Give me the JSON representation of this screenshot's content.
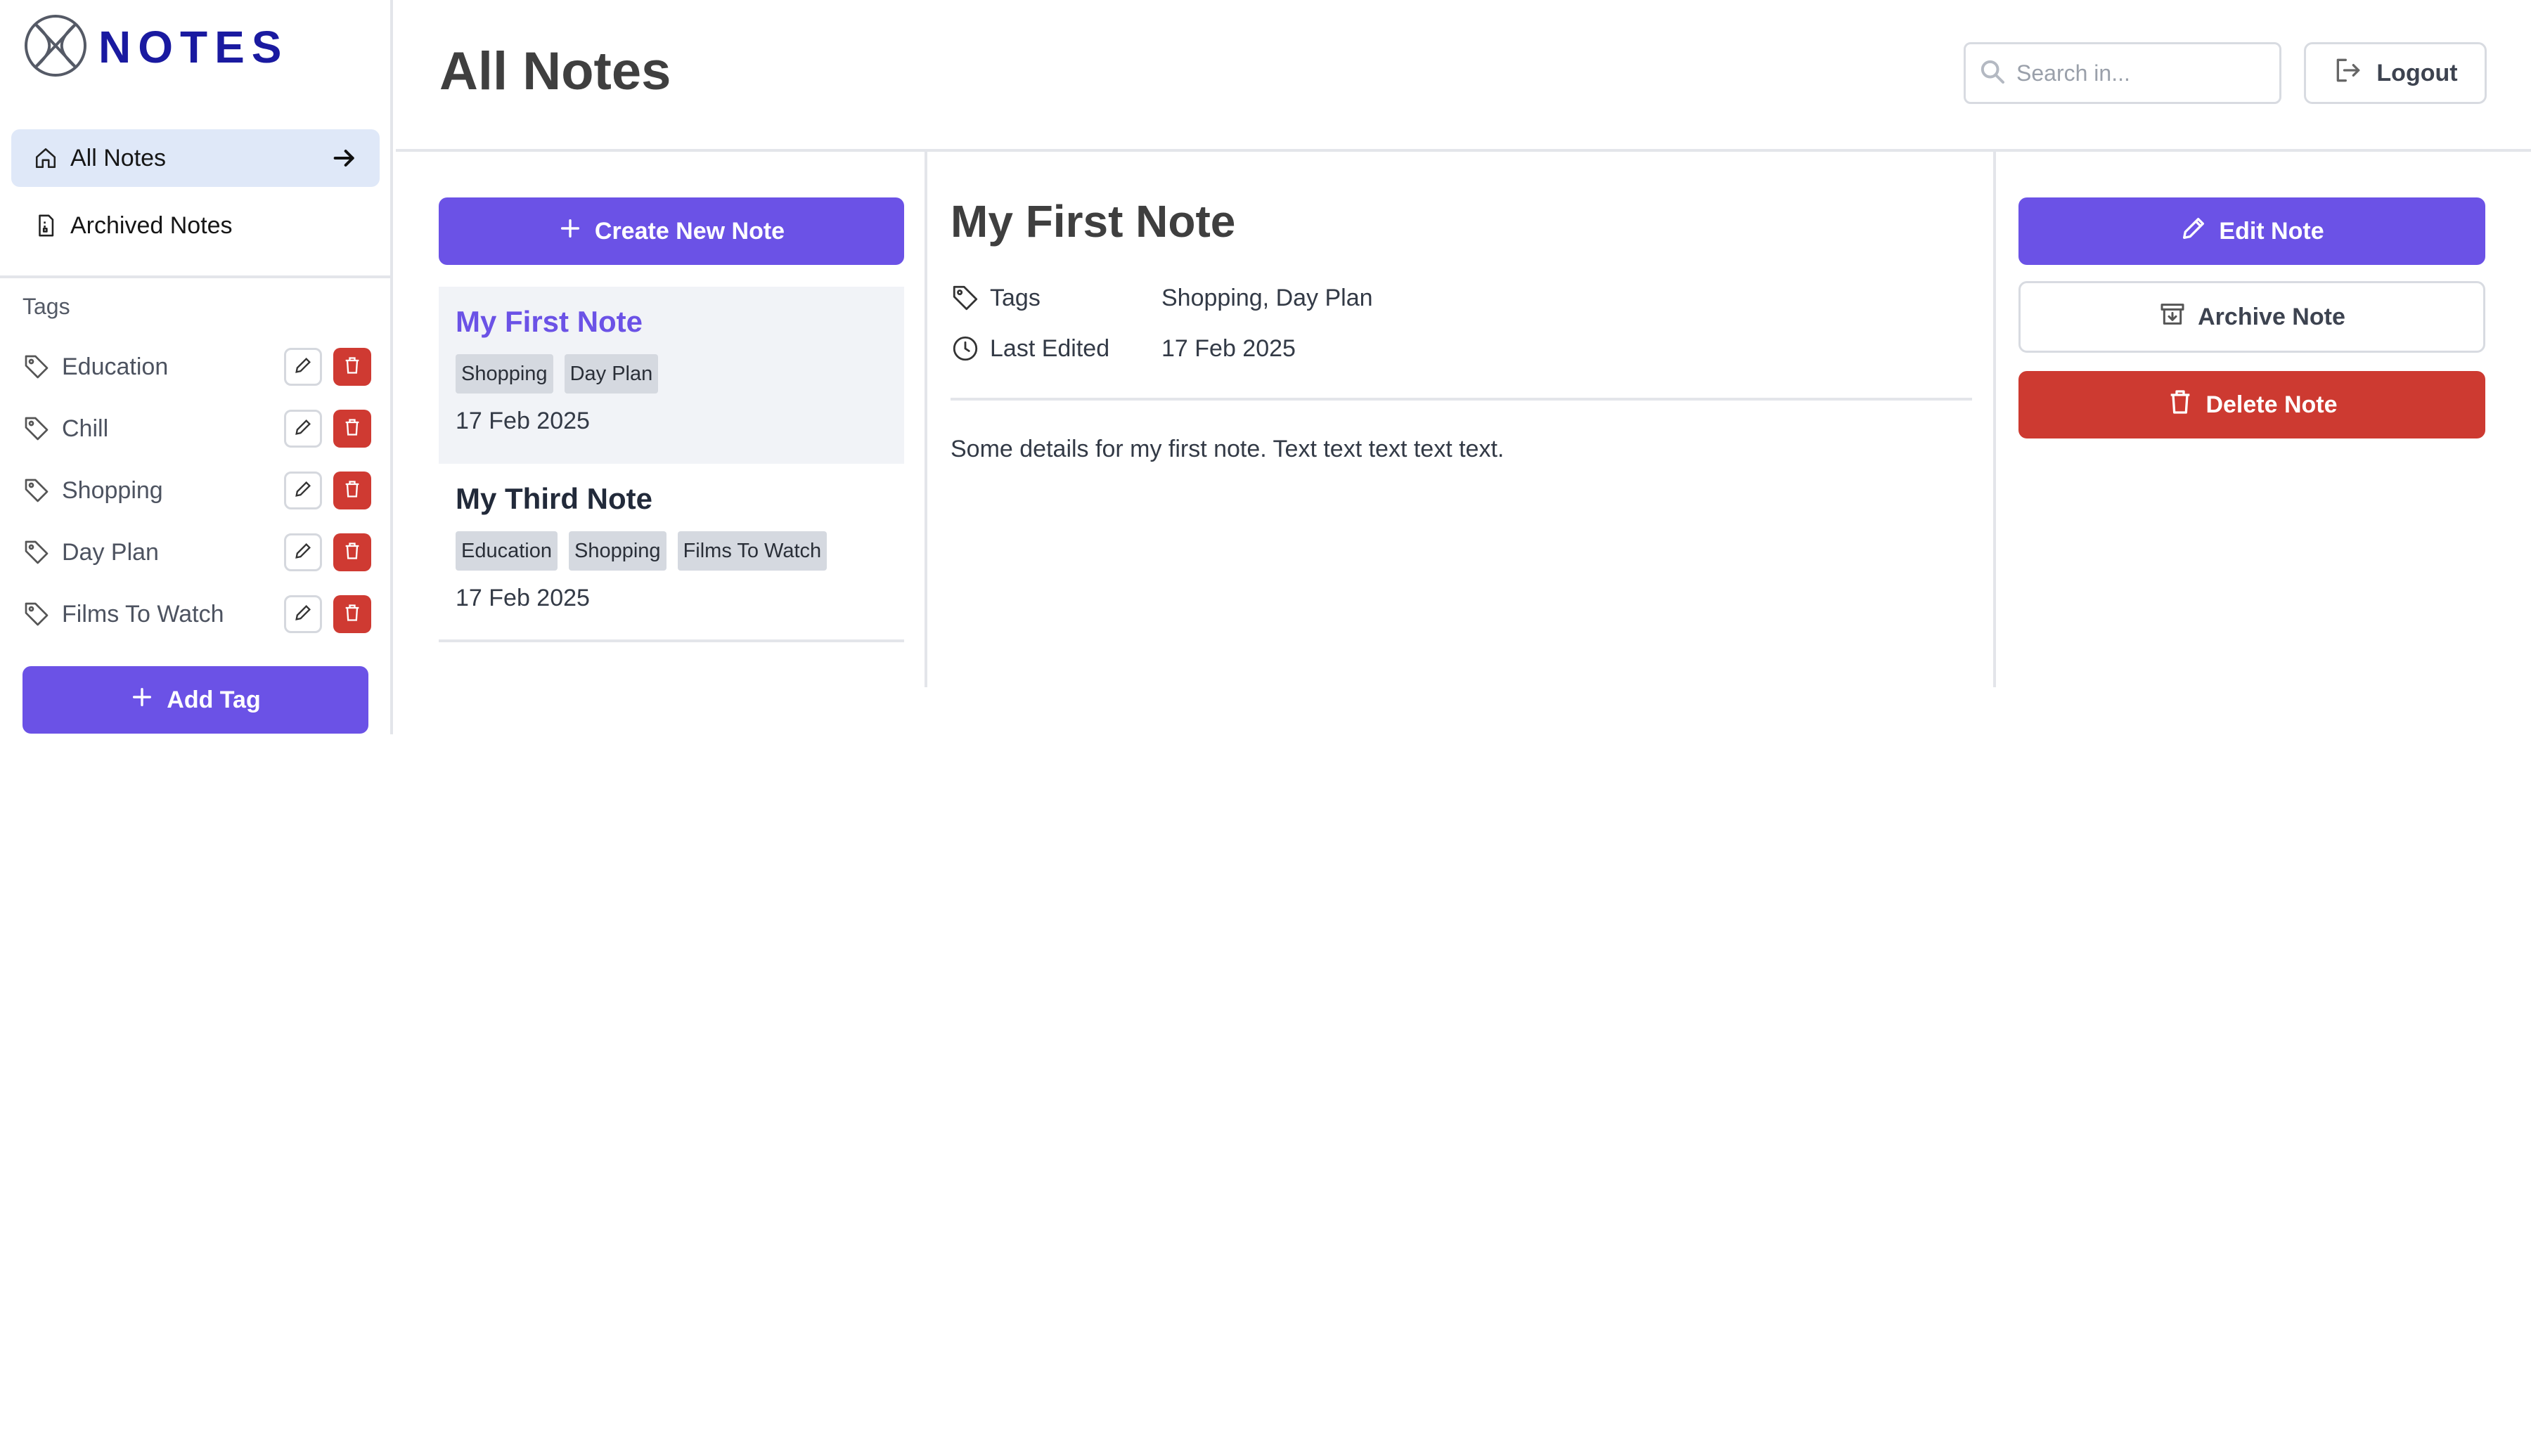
{
  "app": {
    "logo_text": "NOTES"
  },
  "sidebar": {
    "nav": [
      {
        "label": "All Notes",
        "icon": "home-icon",
        "active": true
      },
      {
        "label": "Archived Notes",
        "icon": "archive-file-icon",
        "active": false
      }
    ],
    "tags_heading": "Tags",
    "tags": [
      {
        "label": "Education"
      },
      {
        "label": "Chill"
      },
      {
        "label": "Shopping"
      },
      {
        "label": "Day Plan"
      },
      {
        "label": "Films To Watch"
      }
    ],
    "add_tag_label": "Add Tag"
  },
  "header": {
    "title": "All Notes",
    "search_placeholder": "Search in...",
    "logout_label": "Logout"
  },
  "list": {
    "create_label": "Create New Note",
    "notes": [
      {
        "title": "My First Note",
        "tags": [
          "Shopping",
          "Day Plan"
        ],
        "date": "17 Feb 2025",
        "selected": true
      },
      {
        "title": "My Third Note",
        "tags": [
          "Education",
          "Shopping",
          "Films To Watch"
        ],
        "date": "17 Feb 2025",
        "selected": false
      }
    ]
  },
  "detail": {
    "title": "My First Note",
    "tags_label": "Tags",
    "tags_value": "Shopping, Day Plan",
    "edited_label": "Last Edited",
    "edited_value": "17 Feb 2025",
    "body": "Some details for my first note. Text text text text text."
  },
  "actions": {
    "edit_label": "Edit Note",
    "archive_label": "Archive Note",
    "delete_label": "Delete Note"
  },
  "colors": {
    "accent": "#6b52e6",
    "danger": "#cd3a31",
    "logo": "#1a1aa0",
    "active_nav": "#dfe8f8"
  }
}
